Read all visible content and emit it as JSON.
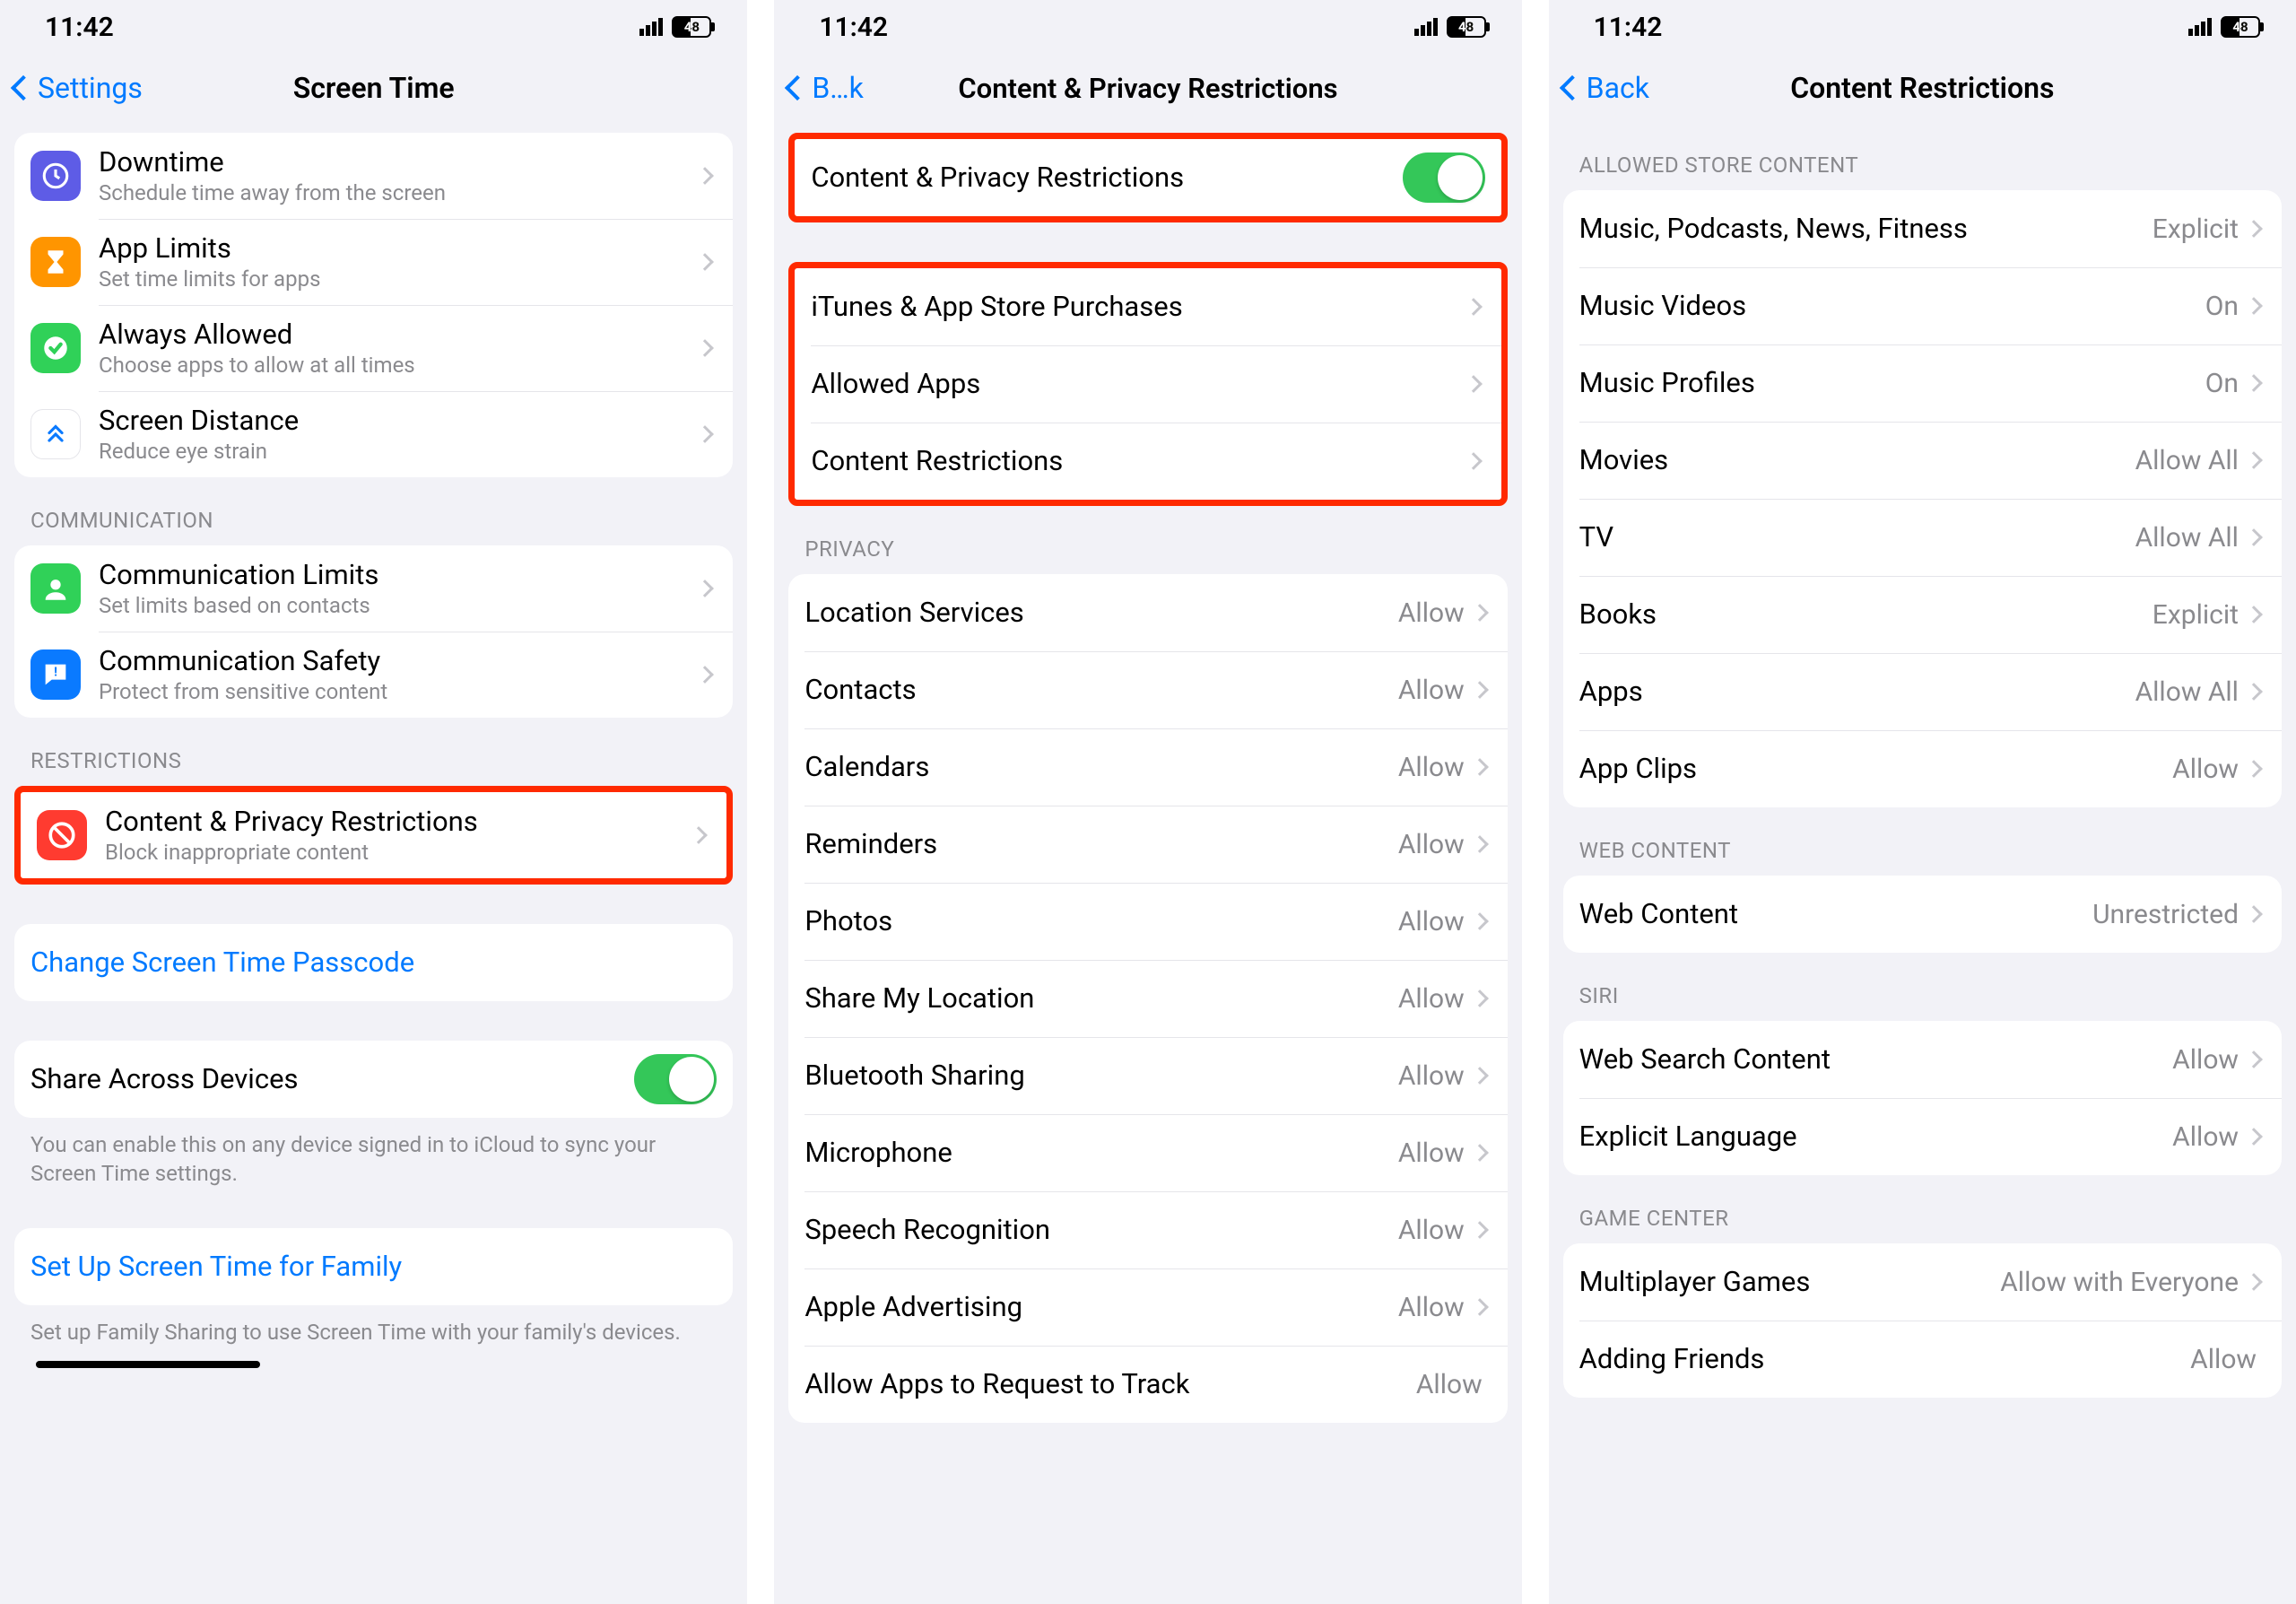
{
  "status": {
    "time": "11:42",
    "battery": "48"
  },
  "screens": [
    {
      "back": "Settings",
      "title": "Screen Time",
      "sections": [
        {
          "rows": [
            {
              "icon": "downtime",
              "color": "#5e5ce6",
              "title": "Downtime",
              "sub": "Schedule time away from the screen",
              "chevron": true
            },
            {
              "icon": "hourglass",
              "color": "#ff9500",
              "title": "App Limits",
              "sub": "Set time limits for apps",
              "chevron": true
            },
            {
              "icon": "check",
              "color": "#30d158",
              "title": "Always Allowed",
              "sub": "Choose apps to allow at all times",
              "chevron": true
            },
            {
              "icon": "distance",
              "color": "#ffffff",
              "title": "Screen Distance",
              "sub": "Reduce eye strain",
              "chevron": true
            }
          ]
        },
        {
          "header": "COMMUNICATION",
          "rows": [
            {
              "icon": "contacts",
              "color": "#30d158",
              "title": "Communication Limits",
              "sub": "Set limits based on contacts",
              "chevron": true
            },
            {
              "icon": "bubble",
              "color": "#0a7aff",
              "title": "Communication Safety",
              "sub": "Protect from sensitive content",
              "chevron": true
            }
          ]
        },
        {
          "header": "RESTRICTIONS",
          "highlight": true,
          "rows": [
            {
              "icon": "nosign",
              "color": "#ff3b30",
              "title": "Content & Privacy Restrictions",
              "sub": "Block inappropriate content",
              "chevron": true
            }
          ]
        },
        {
          "rows": [
            {
              "link": true,
              "title": "Change Screen Time Passcode"
            }
          ]
        },
        {
          "rows": [
            {
              "title": "Share Across Devices",
              "toggle": true
            }
          ],
          "footer": "You can enable this on any device signed in to iCloud to sync your Screen Time settings."
        },
        {
          "rows": [
            {
              "link": true,
              "title": "Set Up Screen Time for Family"
            }
          ],
          "footer": "Set up Family Sharing to use Screen Time with your family's devices."
        }
      ]
    },
    {
      "back": "B…k",
      "title": "Content & Privacy Restrictions",
      "sections": [
        {
          "highlight": true,
          "rows": [
            {
              "title": "Content & Privacy Restrictions",
              "toggle": true
            }
          ]
        },
        {
          "highlight": true,
          "rows": [
            {
              "title": "iTunes & App Store Purchases",
              "chevron": true
            },
            {
              "title": "Allowed Apps",
              "chevron": true
            },
            {
              "title": "Content Restrictions",
              "chevron": true
            }
          ]
        },
        {
          "header": "PRIVACY",
          "rows": [
            {
              "title": "Location Services",
              "value": "Allow",
              "chevron": true
            },
            {
              "title": "Contacts",
              "value": "Allow",
              "chevron": true
            },
            {
              "title": "Calendars",
              "value": "Allow",
              "chevron": true
            },
            {
              "title": "Reminders",
              "value": "Allow",
              "chevron": true
            },
            {
              "title": "Photos",
              "value": "Allow",
              "chevron": true
            },
            {
              "title": "Share My Location",
              "value": "Allow",
              "chevron": true
            },
            {
              "title": "Bluetooth Sharing",
              "value": "Allow",
              "chevron": true
            },
            {
              "title": "Microphone",
              "value": "Allow",
              "chevron": true
            },
            {
              "title": "Speech Recognition",
              "value": "Allow",
              "chevron": true
            },
            {
              "title": "Apple Advertising",
              "value": "Allow",
              "chevron": true
            },
            {
              "title": "Allow Apps to Request to Track",
              "value": "Allow"
            }
          ]
        }
      ]
    },
    {
      "back": "Back",
      "title": "Content Restrictions",
      "sections": [
        {
          "header": "ALLOWED STORE CONTENT",
          "rows": [
            {
              "title": "Music, Podcasts, News, Fitness",
              "value": "Explicit",
              "chevron": true
            },
            {
              "title": "Music Videos",
              "value": "On",
              "chevron": true
            },
            {
              "title": "Music Profiles",
              "value": "On",
              "chevron": true
            },
            {
              "title": "Movies",
              "value": "Allow All",
              "chevron": true
            },
            {
              "title": "TV",
              "value": "Allow All",
              "chevron": true
            },
            {
              "title": "Books",
              "value": "Explicit",
              "chevron": true
            },
            {
              "title": "Apps",
              "value": "Allow All",
              "chevron": true
            },
            {
              "title": "App Clips",
              "value": "Allow",
              "chevron": true
            }
          ]
        },
        {
          "header": "WEB CONTENT",
          "rows": [
            {
              "title": "Web Content",
              "value": "Unrestricted",
              "chevron": true
            }
          ]
        },
        {
          "header": "SIRI",
          "rows": [
            {
              "title": "Web Search Content",
              "value": "Allow",
              "chevron": true
            },
            {
              "title": "Explicit Language",
              "value": "Allow",
              "chevron": true
            }
          ]
        },
        {
          "header": "GAME CENTER",
          "rows": [
            {
              "title": "Multiplayer Games",
              "value": "Allow with Everyone",
              "chevron": true
            },
            {
              "title": "Adding Friends",
              "value": "Allow"
            }
          ]
        }
      ]
    }
  ]
}
